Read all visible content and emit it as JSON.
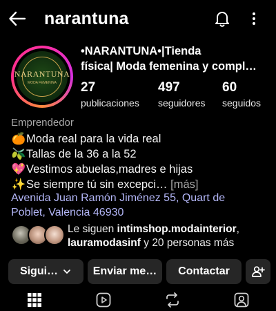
{
  "header": {
    "username": "narantuna",
    "back_icon": "arrow-left-icon",
    "notification_icon": "bell-icon",
    "more_icon": "more-vertical-icon"
  },
  "profile": {
    "avatar_text": "NARANTUNA",
    "avatar_subtext": "MODA FEMENINA",
    "full_name_line1": "•NARANTUNA•|Tienda",
    "full_name_line2": "física| Moda femenina y compl…",
    "stats": [
      {
        "value": "27",
        "label": "publicaciones"
      },
      {
        "value": "497",
        "label": "seguidores"
      },
      {
        "value": "60",
        "label": "seguidos"
      }
    ],
    "category": "Emprendedor",
    "bio": [
      {
        "emoji": "🍊",
        "text": "Moda real para la vida real"
      },
      {
        "emoji": "🫒",
        "text": "Tallas de la 36 a la 52"
      },
      {
        "emoji": "💖",
        "text": "Vestimos abuelas,madres e hijas"
      },
      {
        "emoji": "✨",
        "text": "Se siempre tú sin excepci…",
        "more": "[más]"
      }
    ],
    "address_line1": "Avenida Juan Ramón Jiménez 55, Quart de",
    "address_line2": "Poblet, Valencia 46930"
  },
  "followed_by": {
    "prefix": "Le siguen ",
    "user1": "intimshop.modainterior",
    "separator": ",",
    "user2": "lauramodasinf",
    "suffix": " y 20 personas más"
  },
  "actions": {
    "following": "Sigui…",
    "message": "Enviar me…",
    "contact": "Contactar"
  },
  "colors": {
    "background": "#000000",
    "button": "#262626",
    "address": "#b3b6f7",
    "secondary_text": "#a8a8a8"
  }
}
